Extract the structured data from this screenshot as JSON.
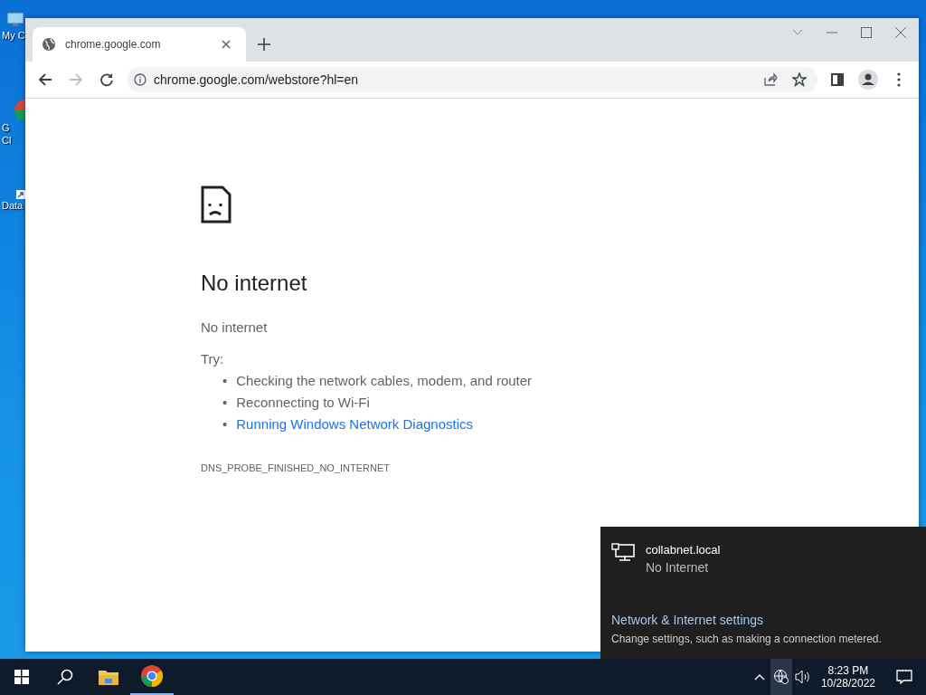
{
  "desktop_icons": [
    {
      "kind": "computer",
      "lines": [
        "My C"
      ]
    },
    {
      "kind": "chrome",
      "lines": [
        "G",
        "Cl"
      ]
    },
    {
      "kind": "data",
      "lines": [
        "Data"
      ]
    }
  ],
  "browser": {
    "tabs": [
      {
        "title": "chrome.google.com",
        "selected": true
      }
    ],
    "address": "chrome.google.com/webstore?hl=en",
    "page": {
      "heading": "No internet",
      "subtitle": "No internet",
      "try_label": "Try:",
      "suggestions": [
        {
          "bullet": "•",
          "text": "Checking the network cables, modem, and router",
          "kind": "text"
        },
        {
          "bullet": "•",
          "text": "Reconnecting to Wi-Fi",
          "kind": "text"
        },
        {
          "bullet": "•",
          "text": "Running Windows Network Diagnostics",
          "kind": "link"
        }
      ],
      "error_code": "DNS_PROBE_FINISHED_NO_INTERNET"
    }
  },
  "network_flyout": {
    "network_name": "collabnet.local",
    "status": "No Internet",
    "settings_link": "Network & Internet settings",
    "settings_hint": "Change settings, such as making a connection metered."
  },
  "taskbar": {
    "time": "8:23 PM",
    "date": "10/28/2022"
  }
}
